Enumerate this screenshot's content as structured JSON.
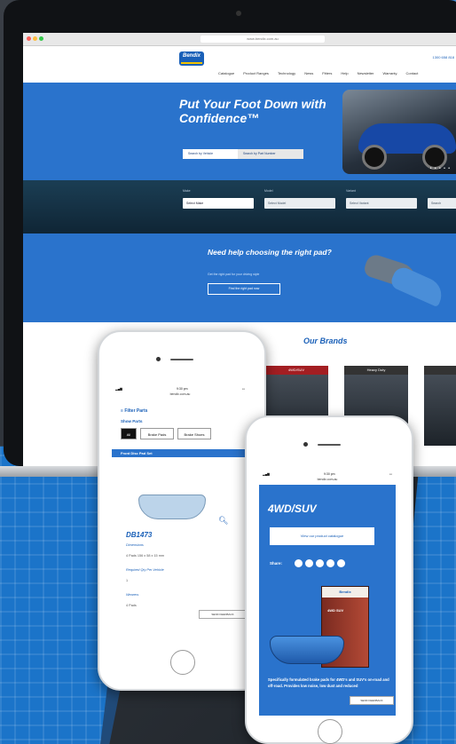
{
  "laptop": {
    "url": "www.bendix.com.au",
    "logo": "Bendix",
    "phone": "1300 658 818",
    "nav": [
      "Catalogue",
      "Product Ranges",
      "Technology",
      "News",
      "Fitters",
      "Help",
      "Newsletter",
      "Warranty",
      "Contact"
    ],
    "hero_title": "Put Your Foot Down with Confidence™",
    "hero_dots": "• • • • •",
    "tab_vehicle": "Search by Vehicle",
    "tab_part": "Search by Part Number",
    "selects": [
      {
        "label": "Make",
        "value": "Select Make"
      },
      {
        "label": "Model",
        "value": "Select Model"
      },
      {
        "label": "Variant",
        "value": "Select Variant"
      },
      {
        "label": "",
        "value": "Search"
      }
    ],
    "help_title": "Need help choosing the right pad?",
    "help_sub": "Get the right pad for your driving style",
    "help_btn": "Find the right pad now",
    "brands_title": "Our Brands",
    "brand_cards": [
      "4WD/SUV",
      "Heavy Duty",
      ""
    ]
  },
  "phone1": {
    "time": "9:30 pm",
    "url": "bendix.com.au",
    "filter": "Filter Parts",
    "show": "Show Parts",
    "segs": [
      "All",
      "Brake Pads",
      "Brake Shoes"
    ],
    "bar": "Front Disc Pad Set",
    "part_number": "DB1473",
    "dimensions_label": "Dimensions",
    "dimensions": "4 Pads 156 x 58 x 15 mm",
    "required_label": "Required Qty Per Vehicle",
    "required": "1",
    "wearers_label": "Wearers",
    "wearers": "4 Pads",
    "feedback": "SEND FEEDBACK"
  },
  "phone2": {
    "time": "9:30 pm",
    "url": "bendix.com.au",
    "title": "4WD/SUV",
    "button": "View our product catalogue",
    "share": "Share:",
    "box_brand": "Bendix",
    "box_text": "4WD SUV",
    "desc": "Specifically formulated brake pads for 4WD's and SUV's on-road and off-road. Provides low noise, low dust and reduced",
    "feedback": "SEND FEEDBACK"
  }
}
